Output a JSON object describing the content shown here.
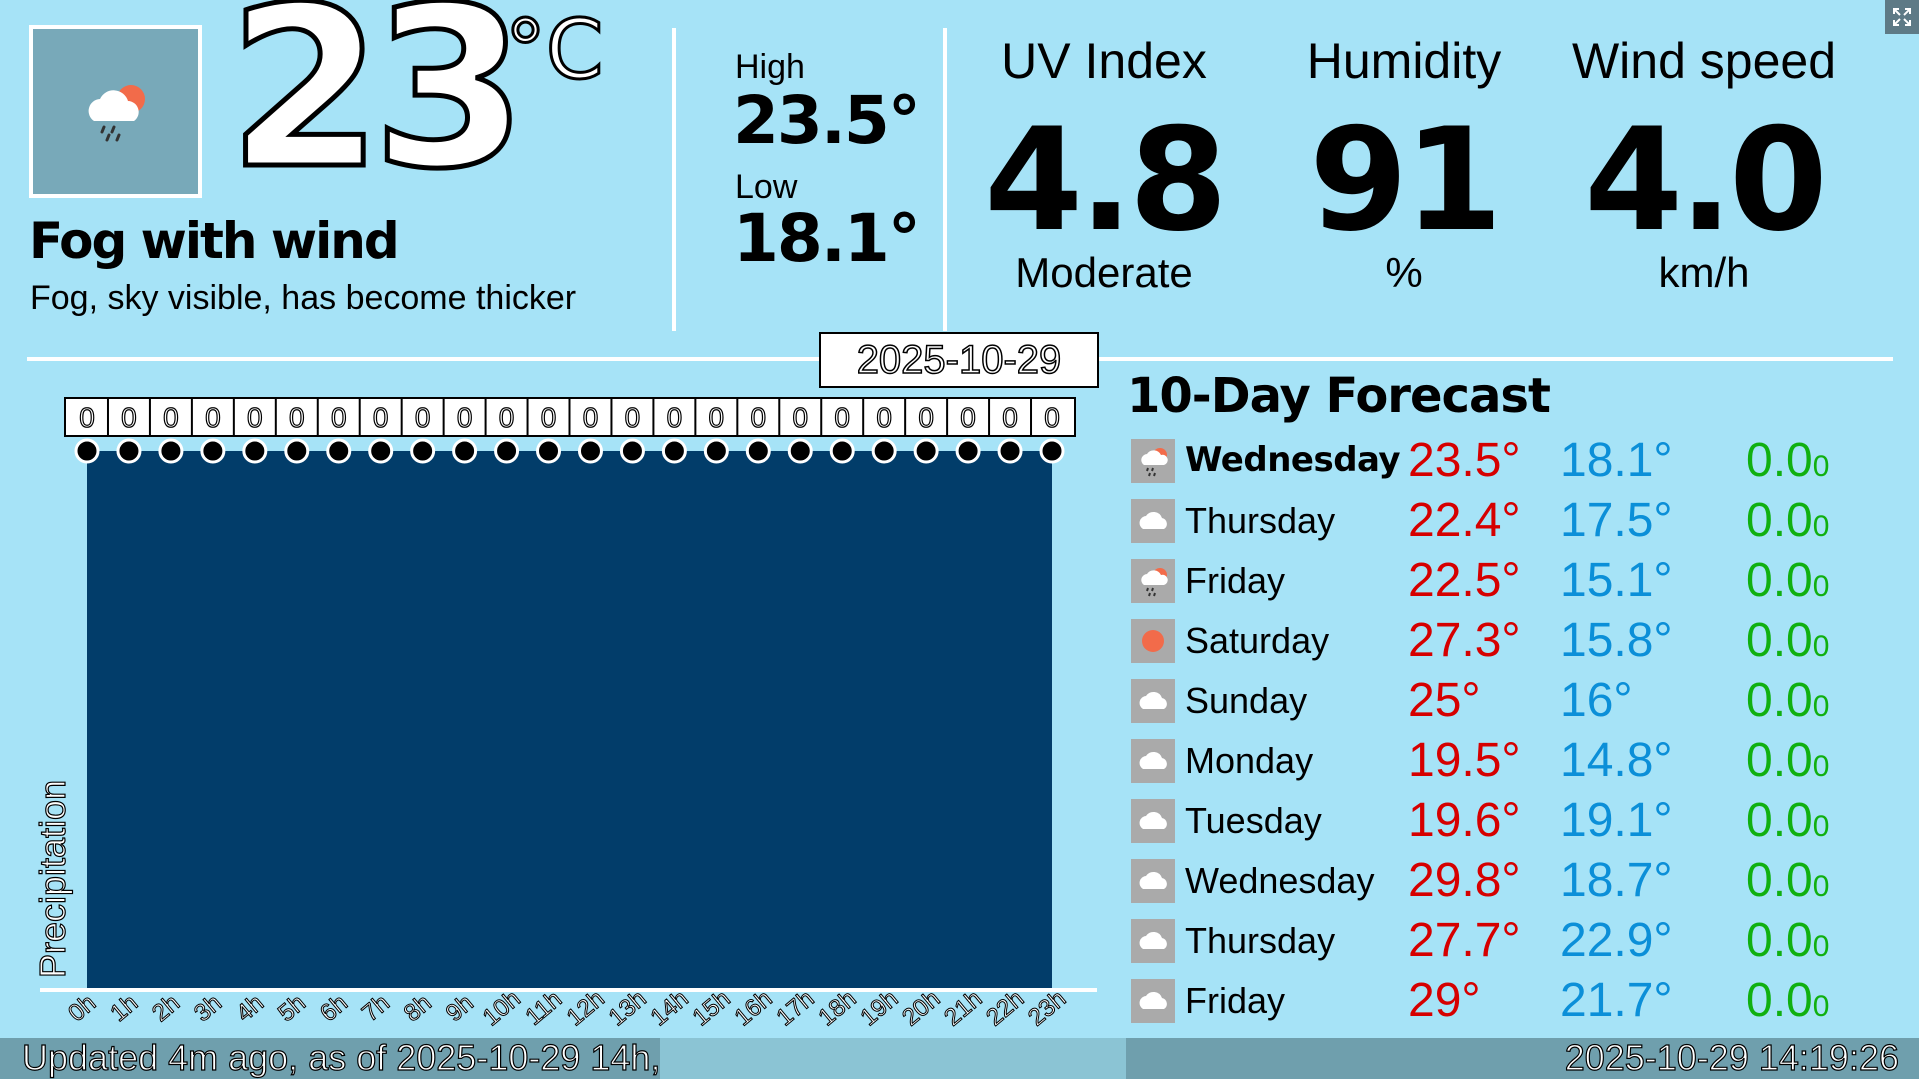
{
  "current": {
    "icon": "cloud-rain-sun-icon",
    "temperature": "23",
    "unit": "°C",
    "condition": "Fog with wind",
    "description": "Fog, sky visible, has become thicker"
  },
  "high_low": {
    "high_label": "High",
    "high_value": "23.5°",
    "low_label": "Low",
    "low_value": "18.1°"
  },
  "stats": {
    "uv_label": "UV Index",
    "uv_value": "4.8",
    "uv_desc": "Moderate",
    "humidity_label": "Humidity",
    "humidity_value": "91",
    "humidity_unit": "%",
    "wind_label": "Wind speed",
    "wind_value": "4.0",
    "wind_unit": "km/h"
  },
  "chart_date": "2025-10-29",
  "chart_data": {
    "type": "bar",
    "ylabel": "Precipitation",
    "categories": [
      "0h",
      "1h",
      "2h",
      "3h",
      "4h",
      "5h",
      "6h",
      "7h",
      "8h",
      "9h",
      "10h",
      "11h",
      "12h",
      "13h",
      "14h",
      "15h",
      "16h",
      "17h",
      "18h",
      "19h",
      "20h",
      "21h",
      "22h",
      "23h"
    ],
    "values": [
      0,
      0,
      0,
      0,
      0,
      0,
      0,
      0,
      0,
      0,
      0,
      0,
      0,
      0,
      0,
      0,
      0,
      0,
      0,
      0,
      0,
      0,
      0,
      0
    ],
    "value_labels": [
      "0",
      "0",
      "0",
      "0",
      "0",
      "0",
      "0",
      "0",
      "0",
      "0",
      "0",
      "0",
      "0",
      "0",
      "0",
      "0",
      "0",
      "0",
      "0",
      "0",
      "0",
      "0",
      "0",
      "0"
    ],
    "plot_fill": "#023d6a"
  },
  "forecast": {
    "title": "10-Day Forecast",
    "days": [
      {
        "day": "Wednesday",
        "high": "23.5°",
        "low": "18.1°",
        "precip": "0.0",
        "precip_unit": "0",
        "icon": "cloud-rain-sun-icon",
        "bold": true
      },
      {
        "day": "Thursday",
        "high": "22.4°",
        "low": "17.5°",
        "precip": "0.0",
        "precip_unit": "0",
        "icon": "cloud-icon"
      },
      {
        "day": "Friday",
        "high": "22.5°",
        "low": "15.1°",
        "precip": "0.0",
        "precip_unit": "0",
        "icon": "cloud-rain-sun-icon"
      },
      {
        "day": "Saturday",
        "high": "27.3°",
        "low": "15.8°",
        "precip": "0.0",
        "precip_unit": "0",
        "icon": "sun-icon"
      },
      {
        "day": "Sunday",
        "high": "25°",
        "low": "16°",
        "precip": "0.0",
        "precip_unit": "0",
        "icon": "cloud-icon"
      },
      {
        "day": "Monday",
        "high": "19.5°",
        "low": "14.8°",
        "precip": "0.0",
        "precip_unit": "0",
        "icon": "cloud-icon"
      },
      {
        "day": "Tuesday",
        "high": "19.6°",
        "low": "19.1°",
        "precip": "0.0",
        "precip_unit": "0",
        "icon": "cloud-icon"
      },
      {
        "day": "Wednesday",
        "high": "29.8°",
        "low": "18.7°",
        "precip": "0.0",
        "precip_unit": "0",
        "icon": "cloud-icon"
      },
      {
        "day": "Thursday",
        "high": "27.7°",
        "low": "22.9°",
        "precip": "0.0",
        "precip_unit": "0",
        "icon": "cloud-icon"
      },
      {
        "day": "Friday",
        "high": "29°",
        "low": "21.7°",
        "precip": "0.0",
        "precip_unit": "0",
        "icon": "cloud-icon"
      }
    ]
  },
  "footer": {
    "updated": "Updated 4m ago, as of 2025-10-29 14h,",
    "clock": "2025-10-29 14:19:26"
  },
  "colors": {
    "background": "#a6e3f7",
    "high": "#d60000",
    "low": "#0b8fd8",
    "precip": "#10b010"
  }
}
